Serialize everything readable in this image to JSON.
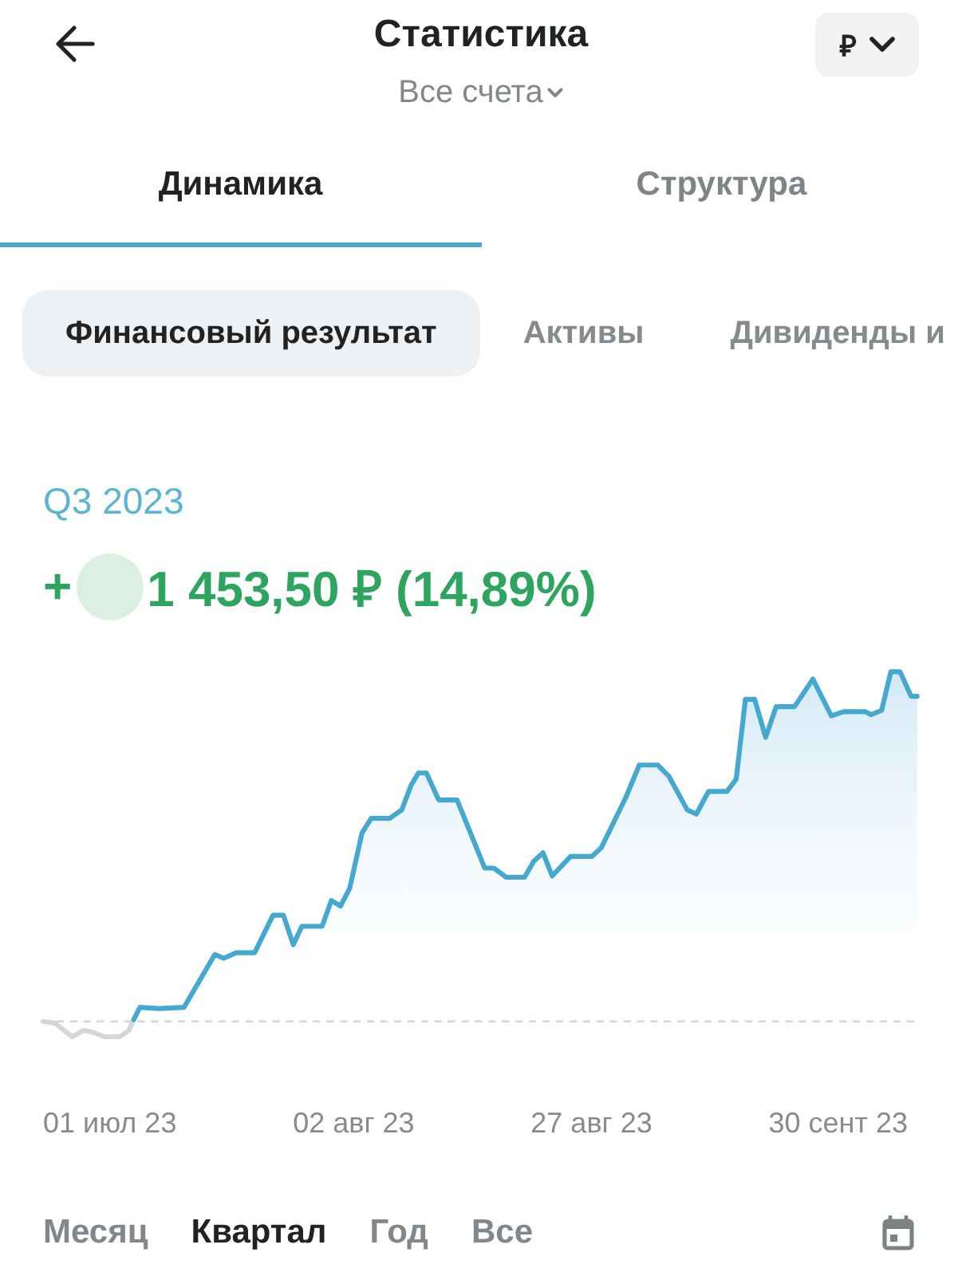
{
  "header": {
    "title": "Статистика",
    "account_selector": "Все счета",
    "currency_button": "₽"
  },
  "tabs": [
    {
      "label": "Динамика",
      "selected": true
    },
    {
      "label": "Структура",
      "selected": false
    }
  ],
  "filters": [
    {
      "label": "Финансовый результат",
      "selected": true
    },
    {
      "label": "Активы",
      "selected": false
    },
    {
      "label": "Дивиденды и",
      "selected": false
    }
  ],
  "result": {
    "period": "Q3 2023",
    "sign": "+",
    "redacted": true,
    "amount": "1 453,50 ₽ (14,89%)"
  },
  "chart": {
    "x_labels": [
      "01 июл 23",
      "02 авг 23",
      "27 авг 23",
      "30 сент 23"
    ]
  },
  "periods": [
    {
      "label": "Месяц",
      "selected": false
    },
    {
      "label": "Квартал",
      "selected": true
    },
    {
      "label": "Год",
      "selected": false
    },
    {
      "label": "Все",
      "selected": false
    }
  ]
}
